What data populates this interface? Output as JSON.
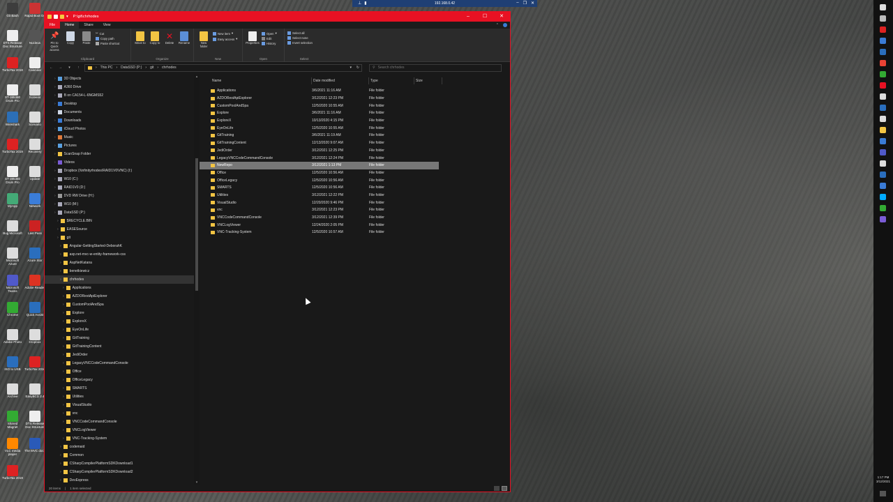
{
  "rdp": {
    "address": "192.168.0.42"
  },
  "desktop_icons": [
    {
      "label": "Git Bash",
      "color": "#3d3d3d"
    },
    {
      "label": "Rapid Boot Os",
      "color": "#c33"
    },
    {
      "label": "DTS Release Doc Structure",
      "color": "#eee"
    },
    {
      "label": "Nucleus",
      "color": "#555"
    },
    {
      "label": "TurboTax 2018",
      "color": "#d22"
    },
    {
      "label": "Calendar",
      "color": "#eee"
    },
    {
      "label": "ST-385360 Drum Pro",
      "color": "#eee"
    },
    {
      "label": "Screens",
      "color": "#ddd"
    },
    {
      "label": "Wireshark",
      "color": "#2c6fb7"
    },
    {
      "label": "Scenario",
      "color": "#ddd"
    },
    {
      "label": "TurboTax 2019",
      "color": "#d22"
    },
    {
      "label": "Recovery",
      "color": "#ddd"
    },
    {
      "label": "ST-385360 Drum Pro",
      "color": "#eee"
    },
    {
      "label": "Update",
      "color": "#ddd"
    },
    {
      "label": "MyApp",
      "color": "#4a7"
    },
    {
      "label": "Network",
      "color": "#3b7dd8"
    },
    {
      "label": "Bug Microsoft",
      "color": "#ddd"
    },
    {
      "label": "Last Pass",
      "color": "#c22"
    },
    {
      "label": "Microsoft Azure",
      "color": "#ddd"
    },
    {
      "label": "Azure Stor",
      "color": "#2a6ebd"
    },
    {
      "label": "Microsoft Teams",
      "color": "#5059c9"
    },
    {
      "label": "Adobe Reader",
      "color": "#d32"
    },
    {
      "label": "Chrome",
      "color": "#3a3"
    },
    {
      "label": "Quick Assist",
      "color": "#2a6ebd"
    },
    {
      "label": "Adobe Photo",
      "color": "#ddd"
    },
    {
      "label": "Dropbox",
      "color": "#ddd"
    },
    {
      "label": "ISO to USB",
      "color": "#2a6ebd"
    },
    {
      "label": "TurboTax 2016",
      "color": "#d22"
    },
    {
      "label": "Archive",
      "color": "#ddd"
    },
    {
      "label": "EasyBCD 2.4",
      "color": "#ddd"
    },
    {
      "label": "Shared Magnet",
      "color": "#3a3"
    },
    {
      "label": "DTS Release Doc Structure",
      "color": "#eee"
    },
    {
      "label": "VLC media player",
      "color": "#f80"
    },
    {
      "label": "The MVC docx",
      "color": "#2a5ab8"
    },
    {
      "label": "TurboTax 2019",
      "color": "#d22"
    }
  ],
  "window": {
    "title": "P:\\git\\chrhodes",
    "tabs": [
      "File",
      "Home",
      "Share",
      "View"
    ],
    "ribbon": {
      "clipboard": {
        "name": "Clipboard",
        "pin_label": "Pin to Quick access",
        "copy_label": "Copy",
        "paste_label": "Paste",
        "cut_label": "Cut",
        "copy_path_label": "Copy path",
        "paste_shortcut_label": "Paste shortcut"
      },
      "organize": {
        "name": "Organize",
        "move_label": "Move to",
        "copy_to_label": "Copy to",
        "delete_label": "Delete",
        "rename_label": "Rename"
      },
      "new": {
        "name": "New",
        "new_folder_label": "New folder",
        "new_item_label": "New item",
        "easy_access_label": "Easy access"
      },
      "open": {
        "name": "Open",
        "properties_label": "Properties",
        "open_label": "Open",
        "edit_label": "Edit",
        "history_label": "History"
      },
      "select": {
        "name": "Select",
        "select_all_label": "Select all",
        "select_none_label": "Select none",
        "invert_label": "Invert selection"
      }
    },
    "address": {
      "crumbs": [
        "This PC",
        "DataSSD (P:)",
        "git",
        "chrhodes"
      ],
      "search_placeholder": "Search chrhodes"
    },
    "nav": [
      {
        "label": "3D Objects",
        "indent": 1,
        "icon": "folder-3d-icon"
      },
      {
        "label": "A360 Drive",
        "indent": 1,
        "icon": "drive-icon"
      },
      {
        "label": "B on CA154-L-6NGMS52",
        "indent": 1,
        "icon": "drive-icon"
      },
      {
        "label": "Desktop",
        "indent": 1,
        "icon": "desktop-icon"
      },
      {
        "label": "Documents",
        "indent": 1,
        "icon": "documents-icon"
      },
      {
        "label": "Downloads",
        "indent": 1,
        "icon": "downloads-icon"
      },
      {
        "label": "iCloud Photos",
        "indent": 1,
        "icon": "photos-icon"
      },
      {
        "label": "Music",
        "indent": 1,
        "icon": "music-icon"
      },
      {
        "label": "Pictures",
        "indent": 1,
        "icon": "pictures-icon"
      },
      {
        "label": "ScanSnap Folder",
        "indent": 1,
        "icon": "folder-icon"
      },
      {
        "label": "Videos",
        "indent": 1,
        "icon": "videos-icon"
      },
      {
        "label": "Dropbox (\\\\infinityrhodes\\RAID1V0\\VNC) (I:)",
        "indent": 1,
        "icon": "drive-icon"
      },
      {
        "label": "W10 (C:)",
        "indent": 1,
        "icon": "drive-icon"
      },
      {
        "label": "RAID1V0 (D:)",
        "indent": 1,
        "icon": "drive-icon"
      },
      {
        "label": "DVD RW Drive (H:)",
        "indent": 1,
        "icon": "dvd-icon"
      },
      {
        "label": "W10 (M:)",
        "indent": 1,
        "icon": "drive-icon"
      },
      {
        "label": "DataSSD (P:)",
        "indent": 1,
        "icon": "drive-icon"
      },
      {
        "label": "$RECYCLE.BIN",
        "indent": 2,
        "icon": "folder-icon"
      },
      {
        "label": "EASESource",
        "indent": 2,
        "icon": "folder-icon"
      },
      {
        "label": "git",
        "indent": 2,
        "icon": "folder-icon"
      },
      {
        "label": "Angular-GettingStarted-DeborahK",
        "indent": 3,
        "icon": "folder-icon"
      },
      {
        "label": "asp.net-mvc-w-entity-framework-css",
        "indent": 3,
        "icon": "folder-icon"
      },
      {
        "label": "AspNetKatana",
        "indent": 3,
        "icon": "folder-icon"
      },
      {
        "label": "benetkiewicz",
        "indent": 3,
        "icon": "folder-icon"
      },
      {
        "label": "chrhodes",
        "indent": 3,
        "icon": "folder-icon",
        "selected": true
      },
      {
        "label": "Applications",
        "indent": 4,
        "icon": "folder-icon"
      },
      {
        "label": "AZDORestApiExplorer",
        "indent": 4,
        "icon": "folder-icon"
      },
      {
        "label": "CustomPoolAndSpa",
        "indent": 4,
        "icon": "folder-icon"
      },
      {
        "label": "Explore",
        "indent": 4,
        "icon": "folder-icon"
      },
      {
        "label": "ExploreX",
        "indent": 4,
        "icon": "folder-icon"
      },
      {
        "label": "EyeOnLife",
        "indent": 4,
        "icon": "folder-icon"
      },
      {
        "label": "GitTraining",
        "indent": 4,
        "icon": "folder-icon"
      },
      {
        "label": "GitTrainingContent",
        "indent": 4,
        "icon": "folder-icon"
      },
      {
        "label": "JediOrder",
        "indent": 4,
        "icon": "folder-icon"
      },
      {
        "label": "LegacyVNCCodeCommandConsole",
        "indent": 4,
        "icon": "folder-icon"
      },
      {
        "label": "Office",
        "indent": 4,
        "icon": "folder-icon"
      },
      {
        "label": "OfficeLegacy",
        "indent": 4,
        "icon": "folder-icon"
      },
      {
        "label": "SMARTS",
        "indent": 4,
        "icon": "folder-icon"
      },
      {
        "label": "Utilities",
        "indent": 4,
        "icon": "folder-icon"
      },
      {
        "label": "VisualStudio",
        "indent": 4,
        "icon": "folder-icon"
      },
      {
        "label": "vnc",
        "indent": 4,
        "icon": "folder-icon"
      },
      {
        "label": "VNCCodeCommandConsole",
        "indent": 4,
        "icon": "folder-icon"
      },
      {
        "label": "VNCLogViewer",
        "indent": 4,
        "icon": "folder-icon"
      },
      {
        "label": "VNC-Tracking-System",
        "indent": 4,
        "icon": "folder-icon"
      },
      {
        "label": "codemaid",
        "indent": 3,
        "icon": "folder-icon"
      },
      {
        "label": "Common",
        "indent": 3,
        "icon": "folder-icon"
      },
      {
        "label": "CSharpCompilerPlatformSDKDownload1",
        "indent": 3,
        "icon": "folder-icon"
      },
      {
        "label": "CSharpCompilerPlatformSDKDownload2",
        "indent": 3,
        "icon": "folder-icon"
      },
      {
        "label": "DevExpress",
        "indent": 3,
        "icon": "folder-icon"
      }
    ],
    "columns": [
      "Name",
      "Date modified",
      "Type",
      "Size"
    ],
    "files": [
      {
        "name": "Applications",
        "date": "3/6/2021 11:16 AM",
        "type": "File folder"
      },
      {
        "name": "AZDORestApiExplorer",
        "date": "3/12/2021 12:23 PM",
        "type": "File folder"
      },
      {
        "name": "CustomPoolAndSpa",
        "date": "12/5/2020 10:55 AM",
        "type": "File folder"
      },
      {
        "name": "Explore",
        "date": "3/6/2021 11:16 AM",
        "type": "File folder"
      },
      {
        "name": "ExploreX",
        "date": "10/13/2020 4:15 PM",
        "type": "File folder"
      },
      {
        "name": "EyeOnLife",
        "date": "12/5/2020 10:55 AM",
        "type": "File folder"
      },
      {
        "name": "GitTraining",
        "date": "3/6/2021 11:19 AM",
        "type": "File folder"
      },
      {
        "name": "GitTrainingContent",
        "date": "12/13/2020 9:07 AM",
        "type": "File folder"
      },
      {
        "name": "JediOrder",
        "date": "3/12/2021 12:25 PM",
        "type": "File folder"
      },
      {
        "name": "LegacyVNCCodeCommandConsole",
        "date": "3/12/2021 12:24 PM",
        "type": "File folder"
      },
      {
        "name": "NewRepo",
        "date": "3/12/2021 1:13 PM",
        "type": "File folder",
        "selected": true
      },
      {
        "name": "Office",
        "date": "12/5/2020 10:56 AM",
        "type": "File folder"
      },
      {
        "name": "OfficeLegacy",
        "date": "12/5/2020 10:56 AM",
        "type": "File folder"
      },
      {
        "name": "SMARTS",
        "date": "12/5/2020 10:56 AM",
        "type": "File folder"
      },
      {
        "name": "Utilities",
        "date": "3/12/2021 12:22 PM",
        "type": "File folder"
      },
      {
        "name": "VisualStudio",
        "date": "12/20/2020 9:46 PM",
        "type": "File folder"
      },
      {
        "name": "vnc",
        "date": "3/12/2021 12:23 PM",
        "type": "File folder"
      },
      {
        "name": "VNCCodeCommandConsole",
        "date": "3/12/2021 12:39 PM",
        "type": "File folder"
      },
      {
        "name": "VNCLogViewer",
        "date": "12/24/2020 2:05 PM",
        "type": "File folder"
      },
      {
        "name": "VNC-Tracking-System",
        "date": "12/5/2020 10:57 AM",
        "type": "File folder"
      }
    ],
    "status": {
      "items": "20 items",
      "selected": "1 item selected"
    }
  },
  "taskbar": {
    "time": "1:17 PM",
    "date": "3/12/2021",
    "icon_colors": [
      "#ddd",
      "#bbb",
      "#d22",
      "#3a7bd5",
      "#2a6ebd",
      "#ea4335",
      "#3a3",
      "#e81123",
      "#ddd",
      "#2a6ebd",
      "#ddd",
      "#f2c443",
      "#3a7bd5",
      "#5059c9",
      "#ddd",
      "#2a6ebd",
      "#3a7bd5",
      "#0af",
      "#3a3",
      "#7b5cd6"
    ]
  }
}
